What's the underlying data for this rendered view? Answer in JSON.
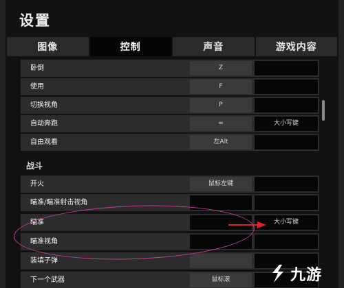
{
  "settings": {
    "title": "设置"
  },
  "tabs": [
    {
      "label": "图像",
      "active": false
    },
    {
      "label": "控制",
      "active": true
    },
    {
      "label": "声音",
      "active": false
    },
    {
      "label": "游戏内容",
      "active": false
    }
  ],
  "rows_top": [
    {
      "label": "卧倒",
      "key1": "Z",
      "key2": ""
    },
    {
      "label": "使用",
      "key1": "F",
      "key2": ""
    },
    {
      "label": "切换视角",
      "key1": "P",
      "key2": ""
    },
    {
      "label": "自动奔跑",
      "key1": "=",
      "key2": "大小写键"
    },
    {
      "label": "自由观看",
      "key1": "左Alt",
      "key2": ""
    }
  ],
  "section_combat": "战斗",
  "rows_combat": [
    {
      "label": "开火",
      "key1": "鼠标左键",
      "key2": ""
    },
    {
      "label": "瞄准/瞄准射击视角",
      "key1": "",
      "key2": ""
    },
    {
      "label": "瞄准",
      "key1": "",
      "key2": "大小写键"
    },
    {
      "label": "瞄准视角",
      "key1": "",
      "key2": ""
    },
    {
      "label": "装填子弹",
      "key1": "",
      "key2": ""
    },
    {
      "label": "下一个武器",
      "key1": "鼠标滚",
      "key2": ""
    }
  ],
  "watermark": {
    "text": "九游"
  },
  "colors": {
    "highlight_ellipse": "#c0409a",
    "arrow": "#e0202a"
  }
}
